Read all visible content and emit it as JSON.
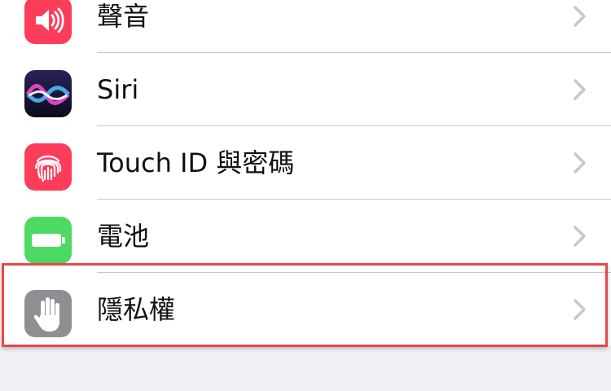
{
  "settings": {
    "rows": [
      {
        "label": "聲音",
        "icon": "speaker-icon",
        "icon_bg": "#fc3d59"
      },
      {
        "label": "Siri",
        "icon": "siri-icon",
        "icon_bg": "#1b1b3a"
      },
      {
        "label": "Touch ID 與密碼",
        "icon": "fingerprint-icon",
        "icon_bg": "#fc3d59"
      },
      {
        "label": "電池",
        "icon": "battery-icon",
        "icon_bg": "#4cd964"
      },
      {
        "label": "隱私權",
        "icon": "hand-icon",
        "icon_bg": "#8e8e93"
      }
    ]
  },
  "highlight": {
    "color": "#e8474c",
    "target": "隱私權"
  }
}
